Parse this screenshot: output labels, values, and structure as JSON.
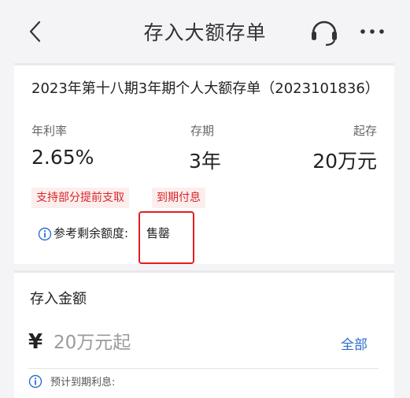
{
  "header": {
    "title": "存入大额存单",
    "back_icon": "chevron-left-icon",
    "support_icon": "headset-icon",
    "more_icon": "more-icon"
  },
  "product": {
    "name": "2023年第十八期3年期个人大额存单（2023101836）",
    "rate_label": "年利率",
    "rate_value": "2.65%",
    "term_label": "存期",
    "term_value": "3年",
    "min_label": "起存",
    "min_value": "20万元",
    "tags": [
      "支持部分提前支取",
      "到期付息"
    ],
    "quota_label": "参考剩余额度:",
    "quota_value": "售罄"
  },
  "deposit": {
    "title": "存入金额",
    "currency_symbol": "¥",
    "placeholder": "20万元起",
    "all_label": "全部",
    "interest_label": "预计到期利息:"
  },
  "colors": {
    "accent_red": "#d5282b",
    "tag_bg": "#fdeeee",
    "link_blue": "#2c6ecf",
    "highlight_border": "#e11e23"
  }
}
